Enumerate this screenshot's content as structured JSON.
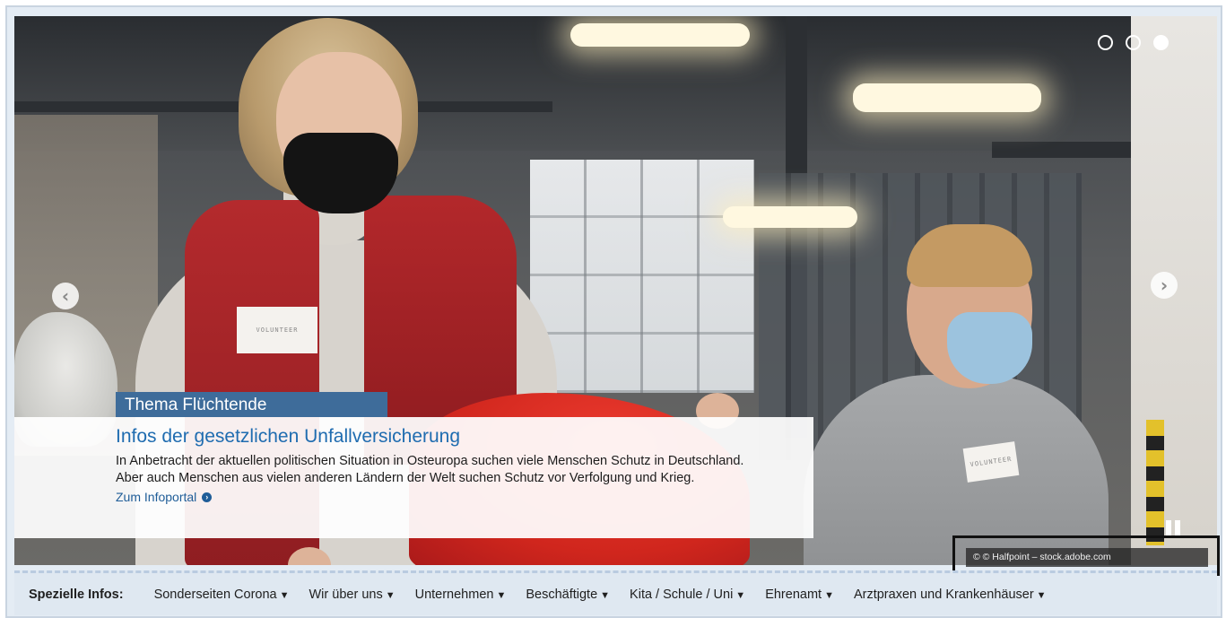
{
  "slider": {
    "dots": 3,
    "active_dot": 3,
    "prev_icon": "chevron-left-circle-icon",
    "next_icon": "chevron-right-circle-icon",
    "pause_icon": "pause-icon",
    "badge_text_left": "VOLUNTEER",
    "badge_text_right": "VOLUNTEER"
  },
  "caption": {
    "tag": "Thema Flüchtende",
    "title": "Infos der gesetzlichen Unfallversicherung",
    "text": "In Anbetracht der aktuellen politischen Situation in Osteuropa suchen viele Menschen Schutz in Deutschland. Aber auch Menschen aus vielen anderen Ländern der Welt suchen Schutz vor Verfolgung und Krieg.",
    "link": "Zum Infoportal",
    "link_icon": "arrow-circle-right-icon"
  },
  "copyright": "© © Halfpoint – stock.adobe.com",
  "nav": {
    "lead": "Spezielle Infos:",
    "items": [
      "Sonderseiten Corona",
      "Wir über uns",
      "Unternehmen",
      "Beschäftigte",
      "Kita / Schule / Uni",
      "Ehrenamt",
      "Arztpraxen und Krankenhäuser"
    ],
    "dropdown_glyph": "▼"
  },
  "colors": {
    "caption_tag_bg": "#3e6c9a",
    "caption_title": "#1f6cb0",
    "nav_bg": "#dfe8f1"
  }
}
